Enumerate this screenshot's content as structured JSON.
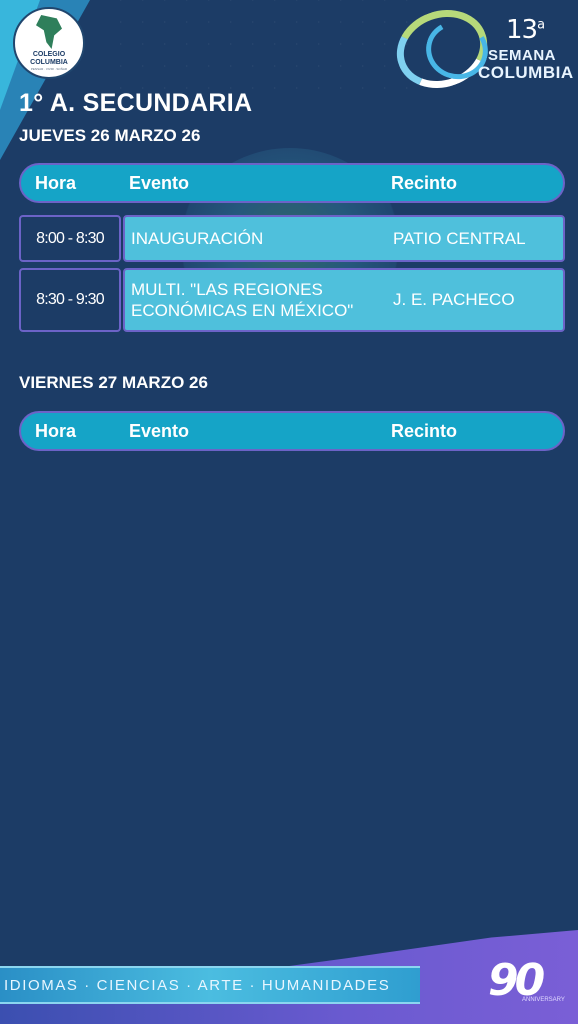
{
  "logo_left": {
    "line1": "COLEGIO",
    "line2": "COLUMBIA",
    "tagline": "PENSAR · VIVIR · SOÑAR"
  },
  "logo_right": {
    "number": "13",
    "ordinal": "a",
    "word1": "SEMANA",
    "word2": "COLUMBIA"
  },
  "page_title": "1° A. SECUNDARIA",
  "headers": {
    "hora": "Hora",
    "evento": "Evento",
    "recinto": "Recinto"
  },
  "days": [
    {
      "title": "JUEVES 26 MARZO 26",
      "rows": [
        {
          "hora": "8:00 - 8:30",
          "evento": "INAUGURACIÓN",
          "recinto": "PATIO CENTRAL"
        },
        {
          "hora": "8:30 - 9:30",
          "evento": "MULTI. \"LAS REGIONES ECONÓMICAS EN MÉXICO\"",
          "recinto": "J. E. PACHECO"
        }
      ]
    },
    {
      "title": "VIERNES 27 MARZO 26",
      "rows": []
    }
  ],
  "footer": {
    "strip": "IDIOMAS · CIENCIAS · ARTE · HUMANIDADES",
    "badge_number": "90",
    "badge_text": "ANNIVERSARY"
  },
  "colors": {
    "background": "#1c3c66",
    "header_bar": "#15a4c7",
    "row_fill": "#4fc0dc",
    "border": "#6c63c7"
  }
}
